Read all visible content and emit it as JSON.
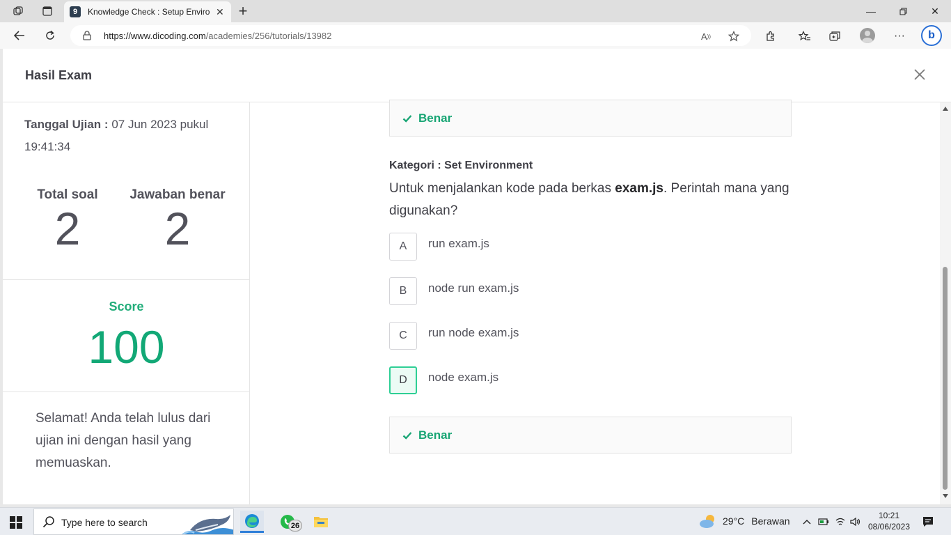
{
  "browser": {
    "tab_title": "Knowledge Check : Setup Environ",
    "tab_favicon_letter": "9",
    "url_domain": "https://www.dicoding.com",
    "url_path": "/academies/256/tutorials/13982"
  },
  "modal": {
    "title": "Hasil Exam"
  },
  "summary": {
    "date_label": "Tanggal Ujian :",
    "date_value": "07 Jun 2023 pukul 19:41:34",
    "total_label": "Total soal",
    "total_value": "2",
    "correct_label": "Jawaban benar",
    "correct_value": "2",
    "score_label": "Score",
    "score_value": "100",
    "message": "Selamat! Anda telah lulus dari ujian ini dengan hasil yang memuaskan."
  },
  "previous_result": {
    "label": "Benar"
  },
  "question": {
    "category_label": "Kategori : Set Environment",
    "text_before": "Untuk menjalankan kode pada berkas ",
    "text_bold": "exam.js",
    "text_after": ". Perintah mana yang digunakan?",
    "options": [
      {
        "letter": "A",
        "text": "run exam.js",
        "selected": false
      },
      {
        "letter": "B",
        "text": "node run exam.js",
        "selected": false
      },
      {
        "letter": "C",
        "text": "run node exam.js",
        "selected": false
      },
      {
        "letter": "D",
        "text": "node exam.js",
        "selected": true
      }
    ],
    "result_label": "Benar"
  },
  "colors": {
    "accent_green": "#12a876",
    "correct_border": "#2ecf95"
  },
  "taskbar": {
    "search_placeholder": "Type here to search",
    "whatsapp_badge": "26",
    "weather_temp": "29°C",
    "weather_desc": "Berawan",
    "time": "10:21",
    "date": "08/06/2023"
  }
}
